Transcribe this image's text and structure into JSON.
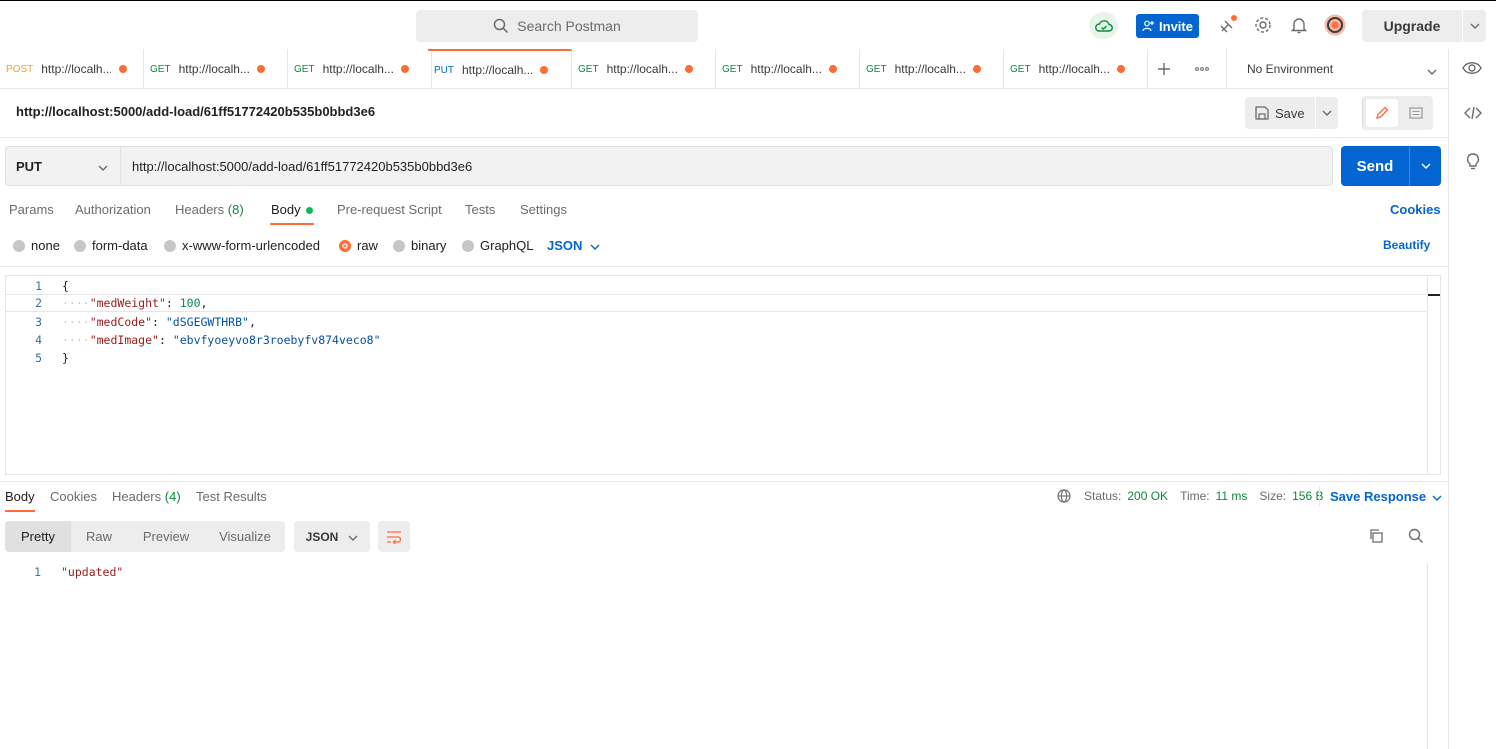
{
  "header": {
    "search_placeholder": "Search Postman",
    "invite_label": "Invite",
    "upgrade_label": "Upgrade"
  },
  "tabs": [
    {
      "method": "POST",
      "url": "http://localh...",
      "method_color": "#f0a22e"
    },
    {
      "method": "GET",
      "url": "http://localh...",
      "method_color": "#0b8a3b"
    },
    {
      "method": "GET",
      "url": "http://localh...",
      "method_color": "#0b8a3b"
    },
    {
      "method": "PUT",
      "url": "http://localh...",
      "method_color": "#0265d2",
      "active": true
    },
    {
      "method": "GET",
      "url": "http://localh...",
      "method_color": "#0b8a3b"
    },
    {
      "method": "GET",
      "url": "http://localh...",
      "method_color": "#0b8a3b"
    },
    {
      "method": "GET",
      "url": "http://localh...",
      "method_color": "#0b8a3b"
    },
    {
      "method": "GET",
      "url": "http://localh...",
      "method_color": "#0b8a3b"
    }
  ],
  "environment": {
    "selected": "No Environment"
  },
  "request": {
    "name": "http://localhost:5000/add-load/61ff51772420b535b0bbd3e6",
    "save_label": "Save",
    "method": "PUT",
    "url": "http://localhost:5000/add-load/61ff51772420b535b0bbd3e6",
    "send_label": "Send",
    "tabs": {
      "params": "Params",
      "authorization": "Authorization",
      "headers": "Headers",
      "headers_count": "(8)",
      "body": "Body",
      "prerequest": "Pre-request Script",
      "tests": "Tests",
      "settings": "Settings"
    },
    "cookies_label": "Cookies",
    "body_options": {
      "none": "none",
      "form_data": "form-data",
      "urlencoded": "x-www-form-urlencoded",
      "raw": "raw",
      "binary": "binary",
      "graphql": "GraphQL",
      "selected_format": "JSON"
    },
    "beautify_label": "Beautify",
    "body_lines": {
      "l1_no": "1",
      "l1": "{",
      "l2_no": "2",
      "l2_key": "\"medWeight\"",
      "l2_val": "100",
      "l3_no": "3",
      "l3_key": "\"medCode\"",
      "l3_val": "\"dSGEGWTHRB\"",
      "l4_no": "4",
      "l4_key": "\"medImage\"",
      "l4_val": "\"ebvfyoeyvo8r3roebyfv874veco8\"",
      "l5_no": "5",
      "l5": "}"
    }
  },
  "response": {
    "tabs": {
      "body": "Body",
      "cookies": "Cookies",
      "headers": "Headers",
      "headers_count": "(4)",
      "test_results": "Test Results"
    },
    "status_label": "Status:",
    "status_value": "200 OK",
    "time_label": "Time:",
    "time_value": "11 ms",
    "size_label": "Size:",
    "size_value": "156 B",
    "save_response_label": "Save Response",
    "view_tabs": {
      "pretty": "Pretty",
      "raw": "Raw",
      "preview": "Preview",
      "visualize": "Visualize"
    },
    "format": "JSON",
    "line_no": "1",
    "line_value": "\"updated\""
  }
}
